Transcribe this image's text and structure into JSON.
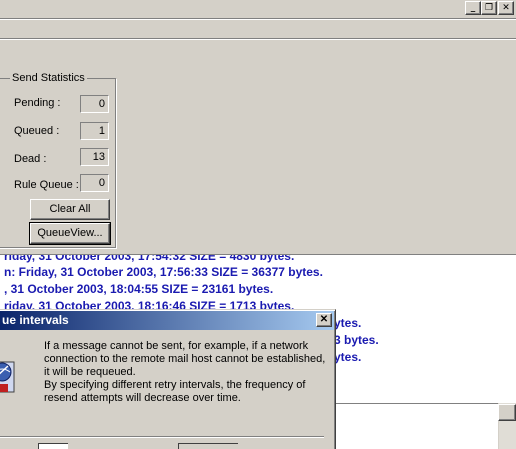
{
  "window": {
    "minimize_glyph": "_",
    "restore_glyph": "❐",
    "close_glyph": "✕"
  },
  "send_statistics": {
    "title": "Send Statistics",
    "pending": {
      "label": "Pending :",
      "value": "0"
    },
    "queued": {
      "label": "Queued :",
      "value": "1"
    },
    "dead": {
      "label": "Dead :",
      "value": "13"
    },
    "rule_queue": {
      "label": "Rule Queue :",
      "value": "0"
    },
    "clear_all_label": "Clear All",
    "queue_view_label": "QueueView..."
  },
  "log": {
    "lines": [
      "riday, 31 October 2003, 17:54:32   SIZE = 4830 bytes.",
      "n: Friday, 31 October 2003, 17:56:33   SIZE = 36377 bytes.",
      ", 31 October 2003, 18:04:55   SIZE = 23161 bytes.",
      "riday, 31 October 2003, 18:16:46   SIZE = 1713 bytes.",
      "ytes.",
      "3 bytes.",
      "ytes."
    ]
  },
  "dialog": {
    "title": "ue intervals",
    "close_glyph": "✕",
    "paragraph1": "If a message cannot be sent, for example, if a network connection to the remote mail host cannot be established, it will be requeued.",
    "paragraph2": "By specifying different retry intervals, the frequency of resend attempts will decrease over time."
  },
  "colors": {
    "log_text": "#1a1ab0",
    "title_bar_start": "#0a246a",
    "title_bar_end": "#a6caf0"
  }
}
